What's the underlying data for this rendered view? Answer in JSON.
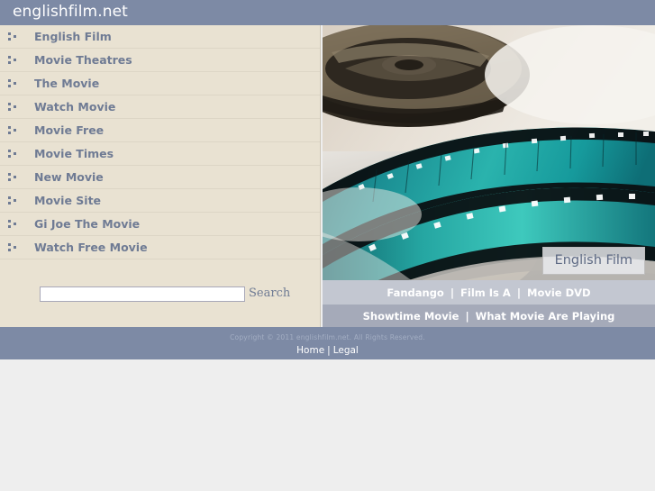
{
  "header": {
    "site_title": "englishfilm.net",
    "bg_color": "#7d8aa5"
  },
  "sidebar": {
    "bg_color": "#e9e2d2",
    "link_color": "#6f7b94",
    "items": [
      {
        "label": "English Film",
        "icon": "bullet-squares-icon"
      },
      {
        "label": "Movie Theatres",
        "icon": "bullet-squares-icon"
      },
      {
        "label": "The Movie",
        "icon": "bullet-squares-icon"
      },
      {
        "label": "Watch Movie",
        "icon": "bullet-squares-icon"
      },
      {
        "label": "Movie Free",
        "icon": "bullet-squares-icon"
      },
      {
        "label": "Movie Times",
        "icon": "bullet-squares-icon"
      },
      {
        "label": "New Movie",
        "icon": "bullet-squares-icon"
      },
      {
        "label": "Movie Site",
        "icon": "bullet-squares-icon"
      },
      {
        "label": "Gi Joe The Movie",
        "icon": "bullet-squares-icon"
      },
      {
        "label": "Watch Free Movie",
        "icon": "bullet-squares-icon"
      }
    ]
  },
  "search": {
    "value": "",
    "placeholder": "",
    "button_label": "Search"
  },
  "hero": {
    "caption": "English Film",
    "alt": "film-reel-photo"
  },
  "linkbar_top": {
    "bg_color": "#c3c7d1",
    "separator": "|",
    "links": [
      "Fandango",
      "Film Is A",
      "Movie DVD"
    ]
  },
  "linkbar_bottom": {
    "bg_color": "#a5aab9",
    "separator": "|",
    "links": [
      "Showtime Movie",
      "What Movie Are Playing"
    ]
  },
  "footer": {
    "bg_color": "#7d8aa5",
    "copyright": "Copyright © 2011 englishfilm.net. All Rights Reserved.",
    "separator": "|",
    "links": [
      "Home",
      "Legal"
    ]
  }
}
